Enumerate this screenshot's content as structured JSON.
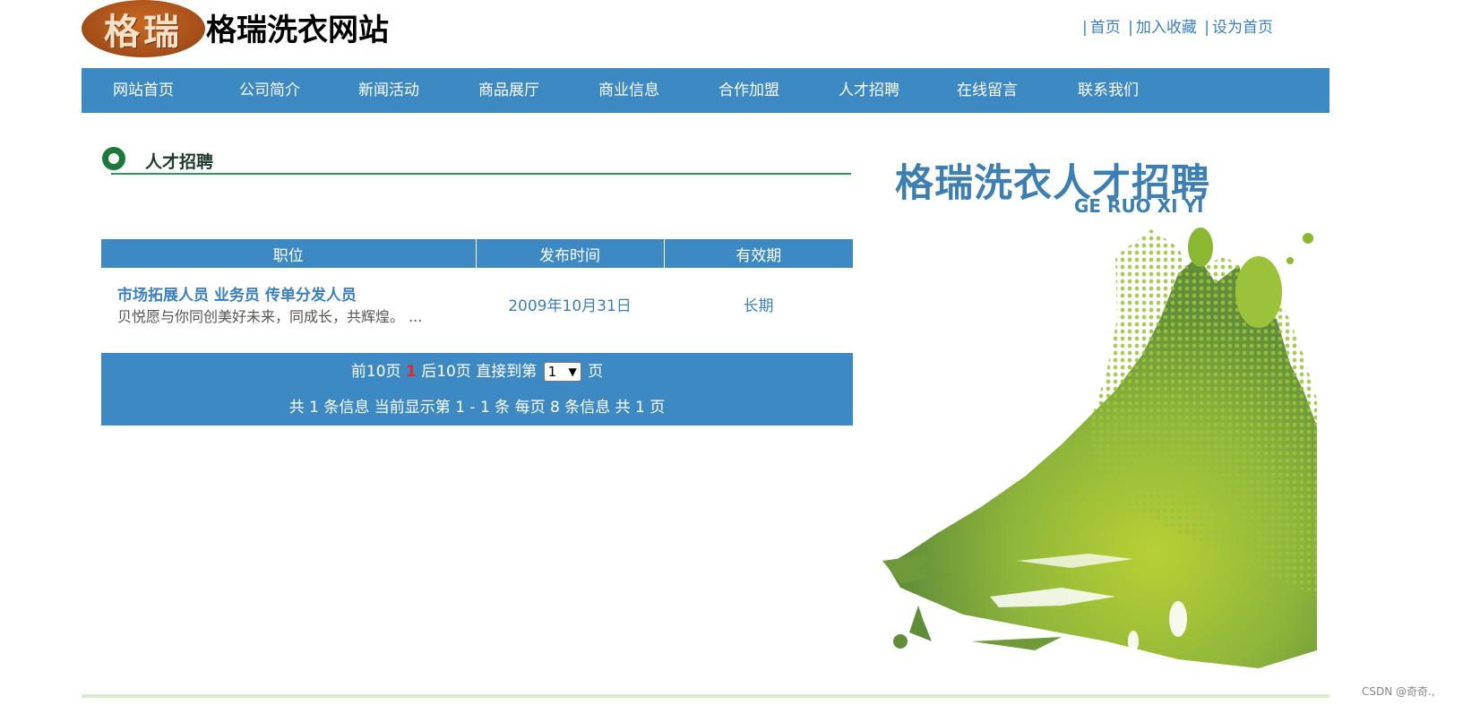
{
  "header": {
    "logo_text": "格瑞",
    "site_title": "格瑞洗衣网站",
    "links": [
      {
        "label": "首页"
      },
      {
        "label": "加入收藏"
      },
      {
        "label": "设为首页"
      }
    ],
    "separator": "|"
  },
  "nav": {
    "items": [
      {
        "label": "网站首页"
      },
      {
        "label": "公司简介"
      },
      {
        "label": "新闻活动"
      },
      {
        "label": "商品展厅"
      },
      {
        "label": "商业信息"
      },
      {
        "label": "合作加盟"
      },
      {
        "label": "人才招聘"
      },
      {
        "label": "在线留言"
      },
      {
        "label": "联系我们"
      }
    ]
  },
  "section": {
    "title": "人才招聘"
  },
  "table": {
    "headers": [
      "职位",
      "发布时间",
      "有效期"
    ],
    "rows": [
      {
        "title": "市场拓展人员 业务员 传单分发人员",
        "desc": "贝悦愿与你同创美好未来，同成长，共辉煌。 ...",
        "date": "2009年10月31日",
        "validity": "长期"
      }
    ]
  },
  "pager": {
    "prev": "前10页",
    "current": "1",
    "next": "后10页",
    "goto": "直接到第",
    "select_value": "1",
    "page_unit": "页",
    "summary": "共 1 条信息 当前显示第 1 - 1 条 每页 8 条信息 共 1 页"
  },
  "banner": {
    "title": "格瑞洗衣人才招聘",
    "subtitle": "GE RUO XI YI"
  },
  "watermark": "CSDN @奇奇.,",
  "colors": {
    "nav_bg": "#3d89c3",
    "link": "#3a7fbf",
    "accent_green": "#8ab833",
    "current_page": "#e8242a"
  }
}
